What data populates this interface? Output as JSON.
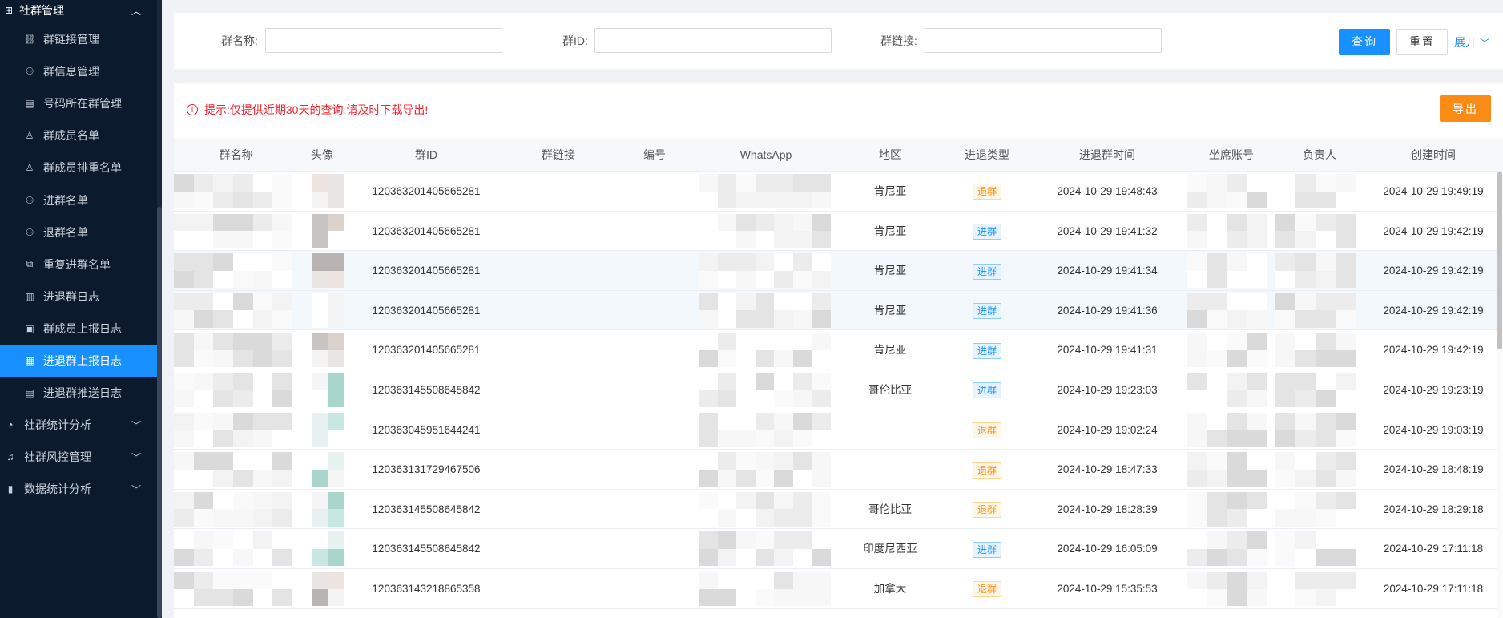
{
  "sidebar": {
    "section_title": "社群管理",
    "items": [
      {
        "label": "群链接管理",
        "icon": "link-icon"
      },
      {
        "label": "群信息管理",
        "icon": "user-group-icon"
      },
      {
        "label": "号码所在群管理",
        "icon": "card-icon"
      },
      {
        "label": "群成员名单",
        "icon": "user-icon"
      },
      {
        "label": "群成员排重名单",
        "icon": "user-icon"
      },
      {
        "label": "进群名单",
        "icon": "user-in-icon"
      },
      {
        "label": "退群名单",
        "icon": "user-out-icon"
      },
      {
        "label": "重复进群名单",
        "icon": "copy-icon"
      },
      {
        "label": "进退群日志",
        "icon": "log-icon"
      },
      {
        "label": "群成员上报日志",
        "icon": "report-icon"
      },
      {
        "label": "进退群上报日志",
        "icon": "report-log-icon",
        "active": true
      },
      {
        "label": "进退群推送日志",
        "icon": "push-log-icon"
      }
    ],
    "groups": [
      {
        "label": "社群统计分析",
        "icon": "pie-chart-icon"
      },
      {
        "label": "社群风控管理",
        "icon": "bell-icon"
      },
      {
        "label": "数据统计分析",
        "icon": "bar-chart-icon"
      }
    ]
  },
  "filters": {
    "group_name_label": "群名称:",
    "group_id_label": "群ID:",
    "group_link_label": "群链接:",
    "group_name_value": "",
    "group_id_value": "",
    "group_link_value": "",
    "query_button": "查询",
    "reset_button": "重置",
    "expand_link": "展开"
  },
  "notice": {
    "text": "提示:仅提供近期30天的查询,请及时下载导出!",
    "color": "#f5222d"
  },
  "export_button": "导出",
  "colors": {
    "primary": "#1890ff",
    "export": "#fa8c16",
    "sidebar_bg": "#0b1a2d"
  },
  "table": {
    "columns": [
      "群名称",
      "头像",
      "群ID",
      "群链接",
      "编号",
      "WhatsApp",
      "地区",
      "进退类型",
      "进退群时间",
      "坐席账号",
      "负责人",
      "创建时间"
    ],
    "rows": [
      {
        "group_id": "120363201405665281",
        "region": "肯尼亚",
        "type": "退群",
        "kind": "out",
        "action_time": "2024-10-29 19:48:43",
        "created": "2024-10-29 19:49:19"
      },
      {
        "group_id": "120363201405665281",
        "region": "肯尼亚",
        "type": "进群",
        "kind": "in",
        "action_time": "2024-10-29 19:41:32",
        "created": "2024-10-29 19:42:19"
      },
      {
        "group_id": "120363201405665281",
        "region": "肯尼亚",
        "type": "进群",
        "kind": "in",
        "action_time": "2024-10-29 19:41:34",
        "created": "2024-10-29 19:42:19"
      },
      {
        "group_id": "120363201405665281",
        "region": "肯尼亚",
        "type": "进群",
        "kind": "in",
        "action_time": "2024-10-29 19:41:36",
        "created": "2024-10-29 19:42:19"
      },
      {
        "group_id": "120363201405665281",
        "region": "肯尼亚",
        "type": "进群",
        "kind": "in",
        "action_time": "2024-10-29 19:41:31",
        "created": "2024-10-29 19:42:19"
      },
      {
        "group_id": "120363145508645842",
        "region": "哥伦比亚",
        "type": "进群",
        "kind": "in",
        "action_time": "2024-10-29 19:23:03",
        "created": "2024-10-29 19:23:19"
      },
      {
        "group_id": "120363045951644241",
        "region": "",
        "type": "退群",
        "kind": "out",
        "action_time": "2024-10-29 19:02:24",
        "created": "2024-10-29 19:03:19"
      },
      {
        "group_id": "120363131729467506",
        "region": "",
        "type": "退群",
        "kind": "out",
        "action_time": "2024-10-29 18:47:33",
        "created": "2024-10-29 18:48:19"
      },
      {
        "group_id": "120363145508645842",
        "region": "哥伦比亚",
        "type": "退群",
        "kind": "out",
        "action_time": "2024-10-29 18:28:39",
        "created": "2024-10-29 18:29:18"
      },
      {
        "group_id": "120363145508645842",
        "region": "印度尼西亚",
        "type": "进群",
        "kind": "in",
        "action_time": "2024-10-29 16:05:09",
        "created": "2024-10-29 17:11:18"
      },
      {
        "group_id": "120363143218865358",
        "region": "加拿大",
        "type": "退群",
        "kind": "out",
        "action_time": "2024-10-29 15:35:53",
        "created": "2024-10-29 17:11:18"
      }
    ]
  }
}
